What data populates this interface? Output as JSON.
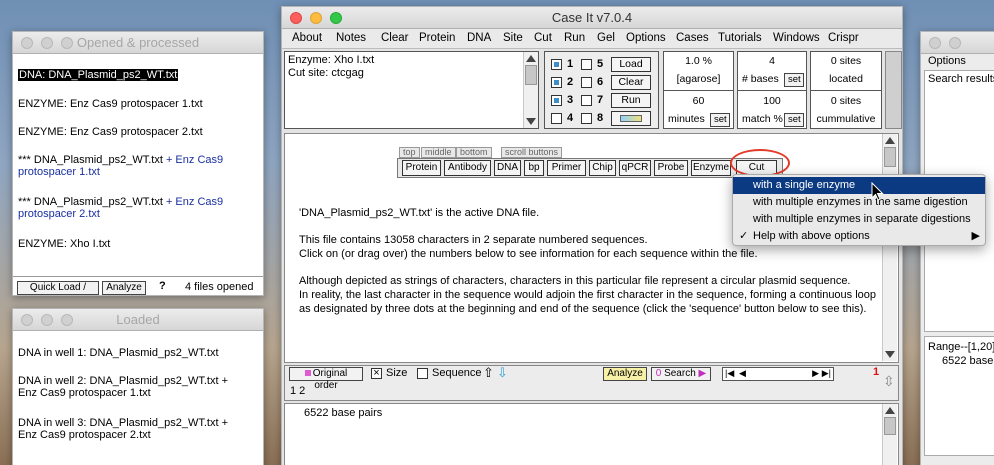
{
  "opened_window": {
    "title": "Opened & processed",
    "items": [
      {
        "text": "DNA: DNA_Plasmid_ps2_WT.txt",
        "extra": "",
        "extra2": "",
        "selected": true
      },
      {
        "text": "ENZYME: Enz Cas9 protospacer 1.txt",
        "extra": "",
        "extra2": ""
      },
      {
        "text": "ENZYME: Enz Cas9 protospacer 2.txt",
        "extra": "",
        "extra2": ""
      },
      {
        "text": "*** DNA_Plasmid_ps2_WT.txt",
        "extra": " + Enz Cas9",
        "extra2": "protospacer 1.txt"
      },
      {
        "text": "*** DNA_Plasmid_ps2_WT.txt",
        "extra": " + Enz Cas9",
        "extra2": "protospacer 2.txt"
      },
      {
        "text": "ENZYME: Xho I.txt",
        "extra": "",
        "extra2": ""
      }
    ],
    "quick_load_label": "Quick Load / Run",
    "analyze_label": "Analyze",
    "help_label": "?",
    "files_opened": "4  files opened"
  },
  "loaded_window": {
    "title": "Loaded",
    "wells": [
      {
        "line1": "DNA in well 1:  DNA_Plasmid_ps2_WT.txt",
        "line2": ""
      },
      {
        "line1": "DNA in well 2:  DNA_Plasmid_ps2_WT.txt +",
        "line2": "Enz Cas9 protospacer 1.txt"
      },
      {
        "line1": "DNA in well 3:  DNA_Plasmid_ps2_WT.txt +",
        "line2": "Enz Cas9 protospacer 2.txt"
      }
    ]
  },
  "main_window": {
    "title": "Case It v7.0.4",
    "menu": [
      "About",
      "Notes",
      "Clear",
      "Protein",
      "DNA",
      "Site",
      "Cut",
      "Run",
      "Gel",
      "Options",
      "Cases",
      "Tutorials",
      "Windows",
      "Crispr"
    ],
    "info": {
      "enzyme": "Enzyme: Xho I.txt",
      "cut_site": "Cut site: ctcgag"
    },
    "wells": [
      {
        "n": "1",
        "checked": true
      },
      {
        "n": "2",
        "checked": true
      },
      {
        "n": "3",
        "checked": true
      },
      {
        "n": "4",
        "checked": false
      },
      {
        "n": "5",
        "checked": false
      },
      {
        "n": "6",
        "checked": false
      },
      {
        "n": "7",
        "checked": false
      },
      {
        "n": "8",
        "checked": false
      }
    ],
    "gel_buttons": {
      "load": "Load",
      "clear": "Clear",
      "run": "Run"
    },
    "stats": {
      "agarose_value": "1.0 %",
      "agarose_label": "[agarose]",
      "bases_value": "4",
      "bases_label": "# bases",
      "set": "set",
      "sites_value": "0  sites",
      "located": "located",
      "minutes_value": "60",
      "minutes_label": "minutes",
      "match_value": "100",
      "match_label": "match %",
      "sites2_value": "0  sites",
      "cumulative": "cummulative"
    },
    "toolbar_tabs": [
      "top",
      "middle",
      "bottom",
      "scroll buttons"
    ],
    "toolbar_buttons": [
      "Protein",
      "Antibody",
      "DNA",
      "bp",
      "Primer",
      "Chip",
      "qPCR",
      "Probe",
      "Enzyme",
      "Cut DNA"
    ],
    "body_text": [
      "'DNA_Plasmid_ps2_WT.txt' is the active DNA file.",
      "This file contains 13058 characters in 2 separate numbered sequences.",
      "Click on (or drag over) the numbers below to see information for each sequence within the file.",
      "Although depicted as strings of characters, characters in this particular file represent a circular plasmid sequence.",
      "In reality, the last character in the sequence would adjoin the first character in the sequence, forming a continuous loop",
      "as designated  by three dots at the beginning and end of the sequence (click the 'sequence' button below to see this)."
    ],
    "context_menu": [
      "with a single enzyme",
      "with multiple enzymes in the same digestion",
      "with multiple enzymes in separate digestions",
      "Help with above options"
    ],
    "bottom_bar": {
      "original_order": "Original order",
      "size": "Size",
      "sequence": "Sequence",
      "analyze": "Analyze",
      "search": "Search",
      "seq_nums": "1  2",
      "count": "1"
    },
    "base_pairs": "6522 base pairs"
  },
  "right_window": {
    "options": "Options",
    "search_results": "Search results",
    "range": "Range--[1,20]",
    "base": "6522 base"
  },
  "colors": {
    "accent_red": "#e23b2a",
    "menu_highlight": "#0b3a83",
    "well_blue": "#3f8fc7"
  }
}
